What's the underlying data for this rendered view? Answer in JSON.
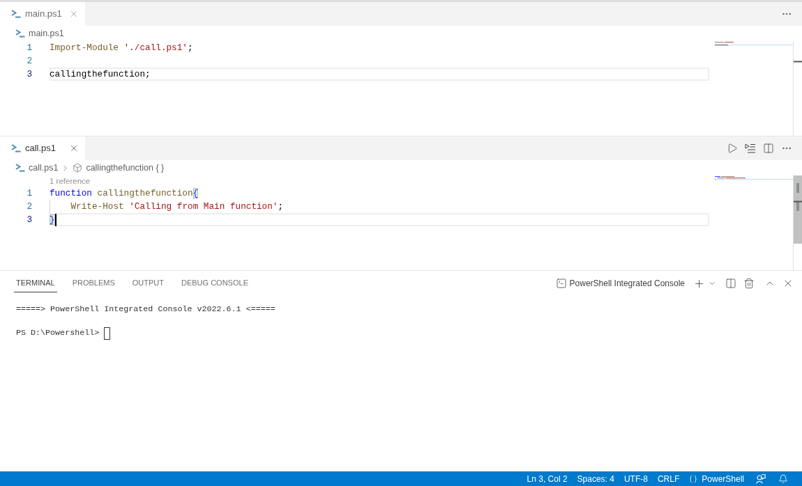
{
  "editor_groups": [
    {
      "focused": false,
      "tabs": [
        {
          "label": "main.ps1",
          "selected": true
        }
      ],
      "breadcrumbs": [
        {
          "kind": "file",
          "text": "main.ps1"
        }
      ],
      "lines": [
        {
          "number": "1",
          "current": false,
          "cursor": false,
          "indented": false,
          "tokens": [
            {
              "kind": "command",
              "text": "Import-Module "
            },
            {
              "kind": "string",
              "text": "'./call.ps1'"
            },
            {
              "kind": "plain",
              "text": ";"
            }
          ]
        },
        {
          "number": "2",
          "current": false,
          "cursor": false,
          "indented": false
        },
        {
          "number": "3",
          "current": true,
          "cursor": false,
          "indented": false,
          "tokens": [
            {
              "kind": "plain",
              "text": "callingthefunction;"
            }
          ]
        }
      ]
    },
    {
      "focused": true,
      "tabs": [
        {
          "label": "call.ps1",
          "selected": true
        }
      ],
      "breadcrumbs": [
        {
          "kind": "file",
          "text": "call.ps1"
        },
        {
          "kind": "function",
          "text": "callingthefunction { }"
        }
      ],
      "lines": [
        {
          "number": "1",
          "codelens": "1 reference",
          "current": false,
          "cursor": false,
          "indented": false,
          "tokens": [
            {
              "kind": "keyword",
              "text": "function "
            },
            {
              "kind": "function",
              "text": "callingthefunction"
            },
            {
              "kind": "bracket",
              "text": "{"
            }
          ]
        },
        {
          "number": "2",
          "current": false,
          "cursor": false,
          "indented": true,
          "tokens": [
            {
              "kind": "command",
              "text": "Write-Host "
            },
            {
              "kind": "string",
              "text": "'Calling from Main function'"
            },
            {
              "kind": "plain",
              "text": ";"
            }
          ]
        },
        {
          "number": "3",
          "current": true,
          "cursor": true,
          "indented": false,
          "tokens": [
            {
              "kind": "bracket",
              "text": "}"
            }
          ]
        }
      ]
    }
  ],
  "panel": {
    "tabs": [
      {
        "label": "TERMINAL",
        "selected": true
      },
      {
        "label": "PROBLEMS",
        "selected": false
      },
      {
        "label": "OUTPUT",
        "selected": false
      },
      {
        "label": "DEBUG CONSOLE",
        "selected": false
      }
    ],
    "terminal_name": "PowerShell Integrated Console",
    "terminal": {
      "banner": "=====> PowerShell Integrated Console v2022.6.1 <=====",
      "prompt": "PS D:\\Powershell>"
    }
  },
  "status_bar": {
    "items": [
      {
        "kind": "text",
        "text": "Ln 3, Col 2"
      },
      {
        "kind": "text",
        "text": "Spaces: 4"
      },
      {
        "kind": "text",
        "text": "UTF-8"
      },
      {
        "kind": "text",
        "text": "CRLF"
      },
      {
        "kind": "language",
        "text": "PowerShell"
      }
    ]
  }
}
